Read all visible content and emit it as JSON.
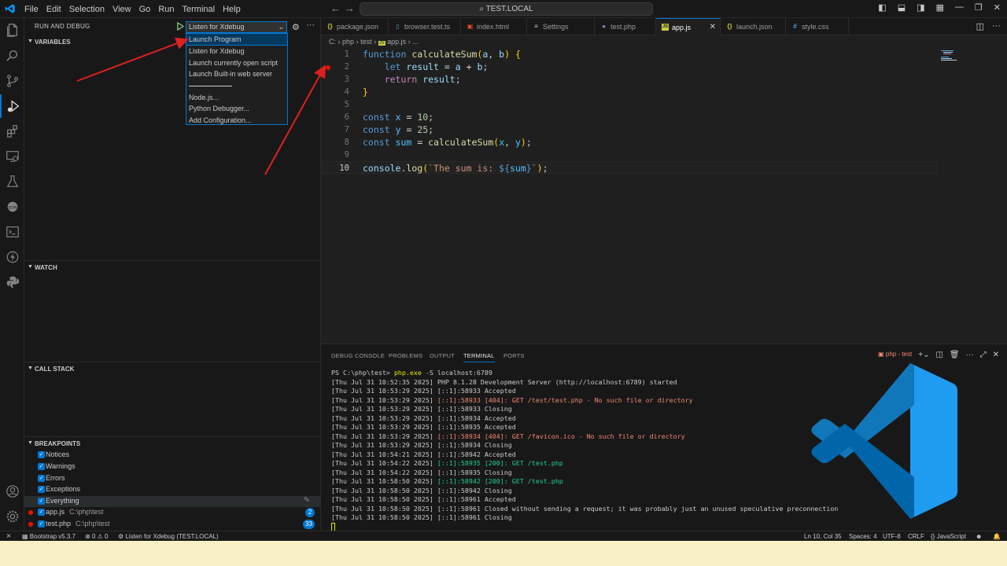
{
  "titlebar": {
    "menu": [
      "File",
      "Edit",
      "Selection",
      "View",
      "Go",
      "Run",
      "Terminal",
      "Help"
    ],
    "search": "TEST.LOCAL"
  },
  "sidebar": {
    "title": "RUN AND DEBUG",
    "config_selected": "Listen for Xdebug",
    "sections": {
      "variables": "VARIABLES",
      "watch": "WATCH",
      "call_stack": "CALL STACK",
      "breakpoints": "BREAKPOINTS"
    },
    "breakpoints": [
      {
        "label": "Notices",
        "path": "",
        "badge": ""
      },
      {
        "label": "Warnings",
        "path": "",
        "badge": ""
      },
      {
        "label": "Errors",
        "path": "",
        "badge": ""
      },
      {
        "label": "Exceptions",
        "path": "",
        "badge": ""
      },
      {
        "label": "Everything",
        "path": "",
        "badge": ""
      },
      {
        "label": "app.js",
        "path": "C:\\php\\test",
        "badge": "2"
      },
      {
        "label": "test.php",
        "path": "C:\\php\\test",
        "badge": "33"
      }
    ]
  },
  "dropdown": {
    "items": [
      "Launch Program",
      "Listen for Xdebug",
      "Launch currently open script",
      "Launch Built-in web server",
      "Node.js...",
      "Python Debugger...",
      "Add Configuration..."
    ]
  },
  "tabs": [
    {
      "label": "package.json",
      "icon": "json-icon",
      "color": "#cbcb41"
    },
    {
      "label": "browser.test.ts",
      "icon": "ts-icon",
      "color": "#519aba"
    },
    {
      "label": "index.html",
      "icon": "html-icon",
      "color": "#e44d26"
    },
    {
      "label": "Settings",
      "icon": "settings-icon",
      "color": "#cccccc"
    },
    {
      "label": "test.php",
      "icon": "php-icon",
      "color": "#a074c4"
    },
    {
      "label": "app.js",
      "icon": "js-icon",
      "color": "#cbcb41"
    },
    {
      "label": "launch.json",
      "icon": "json-icon",
      "color": "#cbcb41"
    },
    {
      "label": "style.css",
      "icon": "css-icon",
      "color": "#42a5f5"
    }
  ],
  "breadcrumb": [
    "C:",
    "php",
    "test",
    "app.js",
    "..."
  ],
  "editor": {
    "line_numbers": [
      "1",
      "2",
      "3",
      "4",
      "5",
      "6",
      "7",
      "8",
      "9",
      "10"
    ]
  },
  "panel": {
    "tabs": [
      "DEBUG CONSOLE",
      "PROBLEMS",
      "OUTPUT",
      "TERMINAL",
      "PORTS"
    ],
    "terminal_name": "php - test",
    "lines": [
      {
        "a": "PS C:\\php\\test> ",
        "b": "php.exe",
        "c": " -S localhost:6789",
        "style": "prompt"
      },
      {
        "a": "[Thu Jul 31 10:52:35 2025] ",
        "b": "PHP 8.1.28 Development Server (http://localhost:6789) started",
        "style": "plain"
      },
      {
        "a": "[Thu Jul 31 10:53:29 2025] ",
        "b": "[::1]:58933 Accepted",
        "style": "plain"
      },
      {
        "a": "[Thu Jul 31 10:53:29 2025] ",
        "b": "[::1]:58933 [404]: GET /test/test.php - No such file or directory",
        "style": "red"
      },
      {
        "a": "[Thu Jul 31 10:53:29 2025] ",
        "b": "[::1]:58933 Closing",
        "style": "plain"
      },
      {
        "a": "[Thu Jul 31 10:53:29 2025] ",
        "b": "[::1]:58934 Accepted",
        "style": "plain"
      },
      {
        "a": "[Thu Jul 31 10:53:29 2025] ",
        "b": "[::1]:58935 Accepted",
        "style": "plain"
      },
      {
        "a": "[Thu Jul 31 10:53:29 2025] ",
        "b": "[::1]:58934 [404]: GET /favicon.ico - No such file or directory",
        "style": "red"
      },
      {
        "a": "[Thu Jul 31 10:53:29 2025] ",
        "b": "[::1]:58934 Closing",
        "style": "plain"
      },
      {
        "a": "[Thu Jul 31 10:54:21 2025] ",
        "b": "[::1]:58942 Accepted",
        "style": "plain"
      },
      {
        "a": "[Thu Jul 31 10:54:22 2025] ",
        "b": "[::1]:58935 [200]: GET /test.php",
        "style": "green"
      },
      {
        "a": "[Thu Jul 31 10:54:22 2025] ",
        "b": "[::1]:58935 Closing",
        "style": "plain"
      },
      {
        "a": "[Thu Jul 31 10:58:50 2025] ",
        "b": "[::1]:58942 [200]: GET /test.php",
        "style": "green"
      },
      {
        "a": "[Thu Jul 31 10:58:50 2025] ",
        "b": "[::1]:58942 Closing",
        "style": "plain"
      },
      {
        "a": "[Thu Jul 31 10:58:50 2025] ",
        "b": "[::1]:58961 Accepted",
        "style": "plain"
      },
      {
        "a": "[Thu Jul 31 10:58:50 2025] ",
        "b": "[::1]:58961 Closed without sending a request; it was probably just an unused speculative preconnection",
        "style": "plain"
      },
      {
        "a": "[Thu Jul 31 10:58:50 2025] ",
        "b": "[::1]:58961 Closing",
        "style": "plain"
      }
    ]
  },
  "statusbar": {
    "bootstrap": "Bootstrap v5.3.7",
    "errors": "0",
    "warnings": "0",
    "debug": "Listen for Xdebug (TEST.LOCAL)",
    "position": "Ln 10, Col 35",
    "spaces": "Spaces: 4",
    "encoding": "UTF-8",
    "eol": "CRLF",
    "language": "JavaScript"
  },
  "colors": {
    "accent": "#0078d4",
    "breakpoint": "#e51400",
    "arrow": "#e02020"
  }
}
